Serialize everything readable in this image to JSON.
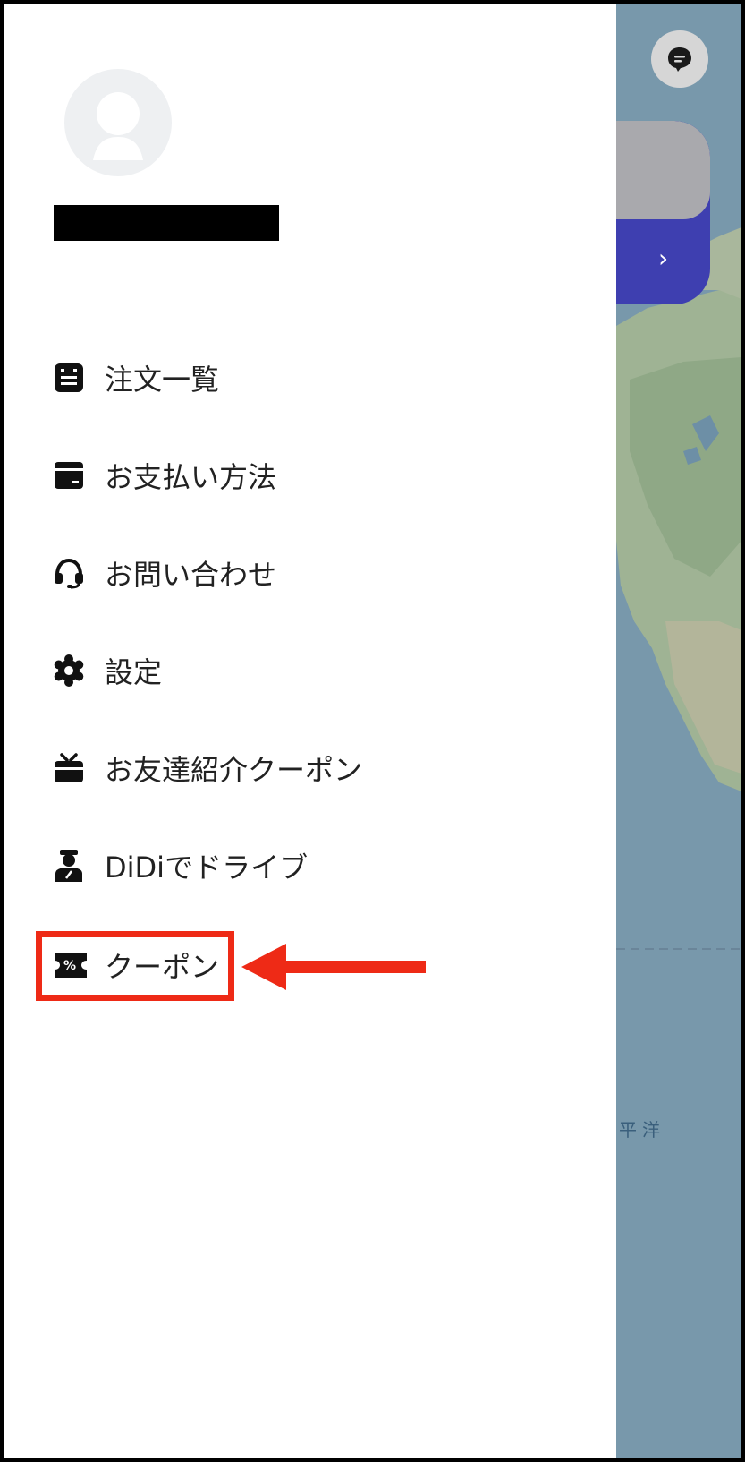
{
  "menu": {
    "items": [
      {
        "label": "注文一覧",
        "icon": "order-list-icon"
      },
      {
        "label": "お支払い方法",
        "icon": "wallet-icon"
      },
      {
        "label": "お問い合わせ",
        "icon": "headset-icon"
      },
      {
        "label": "設定",
        "icon": "gear-icon"
      },
      {
        "label": "お友達紹介クーポン",
        "icon": "gift-icon"
      },
      {
        "label": "DiDiでドライブ",
        "icon": "driver-icon"
      },
      {
        "label": "クーポン",
        "icon": "coupon-icon"
      }
    ]
  },
  "map": {
    "ocean_label": "平洋"
  },
  "coupon_icon_text": "%",
  "card": {
    "arrow": "›"
  },
  "colors": {
    "highlight": "#ee2a16",
    "card": "#3e3fb0",
    "ocean": "#7898ab"
  }
}
